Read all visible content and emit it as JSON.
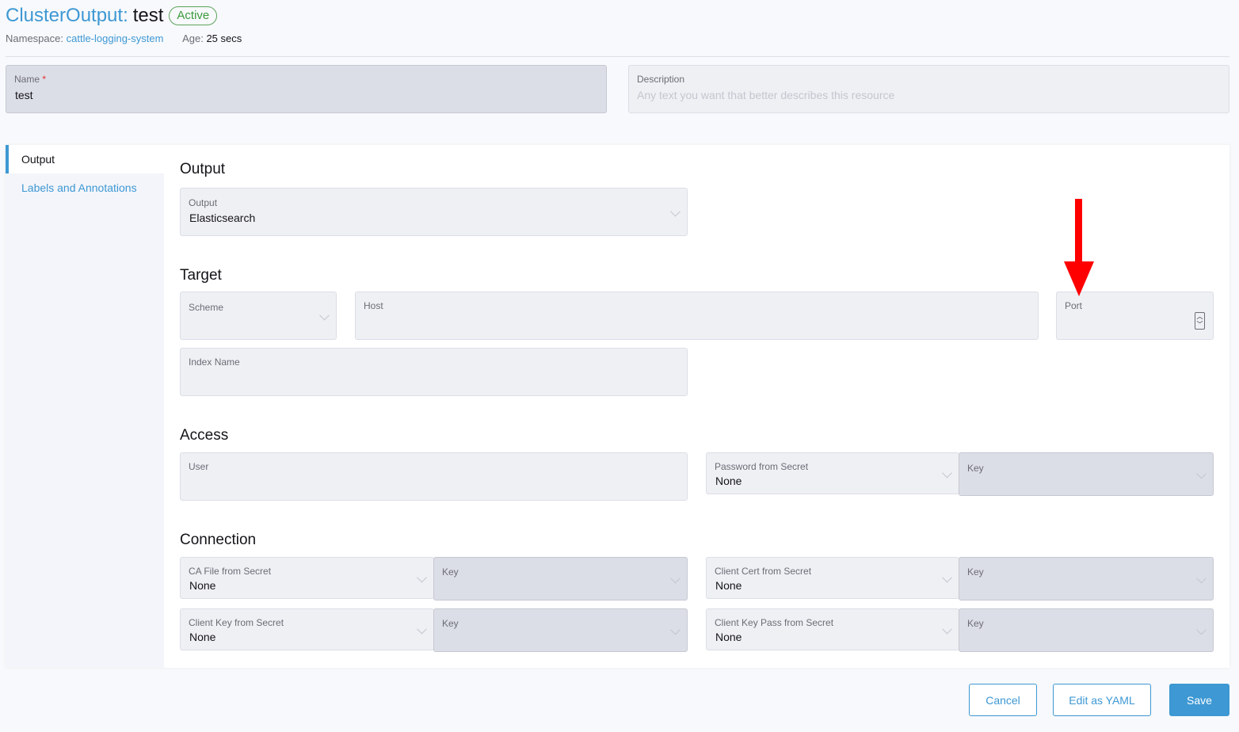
{
  "header": {
    "kind": "ClusterOutput:",
    "name": "test",
    "state": "Active",
    "namespace_label": "Namespace:",
    "namespace": "cattle-logging-system",
    "age_label": "Age:",
    "age": "25 secs"
  },
  "name_field": {
    "label": "Name",
    "required": "*",
    "value": "test"
  },
  "description_field": {
    "label": "Description",
    "placeholder": "Any text you want that better describes this resource"
  },
  "sidebar": {
    "items": [
      {
        "label": "Output"
      },
      {
        "label": "Labels and Annotations"
      }
    ]
  },
  "output_section": {
    "title": "Output",
    "output_field": {
      "label": "Output",
      "value": "Elasticsearch"
    }
  },
  "target_section": {
    "title": "Target",
    "scheme": {
      "label": "Scheme"
    },
    "host": {
      "label": "Host"
    },
    "port": {
      "label": "Port"
    },
    "index_name": {
      "label": "Index Name"
    }
  },
  "access_section": {
    "title": "Access",
    "user": {
      "label": "User"
    },
    "password_secret": {
      "label": "Password from Secret",
      "value": "None"
    },
    "password_key": {
      "label": "Key"
    }
  },
  "connection_section": {
    "title": "Connection",
    "ca_file": {
      "label": "CA File from Secret",
      "value": "None"
    },
    "ca_key": {
      "label": "Key"
    },
    "client_cert": {
      "label": "Client Cert from Secret",
      "value": "None"
    },
    "client_cert_key": {
      "label": "Key"
    },
    "client_key": {
      "label": "Client Key from Secret",
      "value": "None"
    },
    "client_key_key": {
      "label": "Key"
    },
    "client_key_pass": {
      "label": "Client Key Pass from Secret",
      "value": "None"
    },
    "client_key_pass_key": {
      "label": "Key"
    }
  },
  "footer": {
    "cancel": "Cancel",
    "edit_yaml": "Edit as YAML",
    "save": "Save"
  },
  "colors": {
    "accent": "#3d98d3",
    "success": "#3b9a3b",
    "annotation_arrow": "#ff0000"
  },
  "icons": {
    "select_chevron": "chevron-down-icon",
    "number_spinner": "spinner-icon",
    "annotation": "red-arrow-down-icon"
  }
}
